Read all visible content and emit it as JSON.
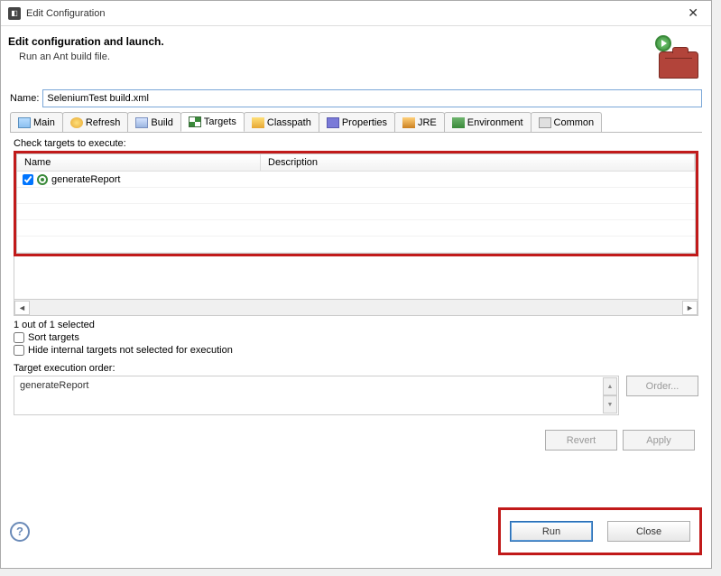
{
  "window": {
    "title": "Edit Configuration",
    "close": "✕"
  },
  "header": {
    "title": "Edit configuration and launch.",
    "subtitle": "Run an Ant build file."
  },
  "name_field": {
    "label": "Name:",
    "value": "SeleniumTest build.xml"
  },
  "tabs": {
    "main": "Main",
    "refresh": "Refresh",
    "build": "Build",
    "targets": "Targets",
    "classpath": "Classpath",
    "properties": "Properties",
    "jre": "JRE",
    "environment": "Environment",
    "common": "Common"
  },
  "targets_panel": {
    "check_label": "Check targets to execute:",
    "col_name": "Name",
    "col_desc": "Description",
    "rows": [
      {
        "checked": true,
        "name": "generateReport",
        "desc": ""
      }
    ],
    "status": "1 out of 1 selected",
    "sort_label": "Sort targets",
    "hide_label": "Hide internal targets not selected for execution",
    "order_label": "Target execution order:",
    "order_value": "generateReport",
    "order_button": "Order..."
  },
  "buttons": {
    "revert": "Revert",
    "apply": "Apply",
    "run": "Run",
    "close": "Close"
  }
}
